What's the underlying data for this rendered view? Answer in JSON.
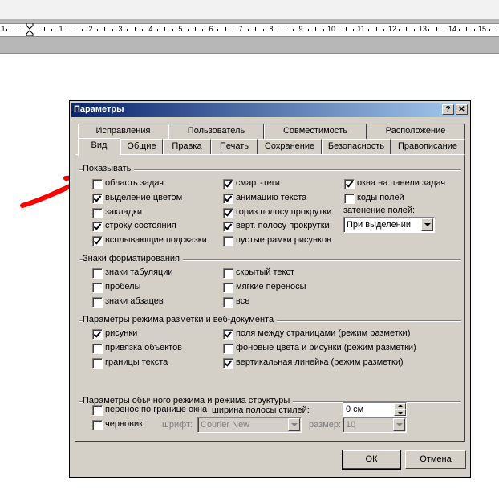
{
  "ruler": {
    "numbers": [
      "1",
      "1",
      "2",
      "3",
      "4",
      "5",
      "6",
      "7",
      "8",
      "9",
      "10",
      "11",
      "12",
      "13",
      "14",
      "15"
    ]
  },
  "dialog": {
    "title": "Параметры",
    "help_button": "?",
    "close_button": "✕",
    "tabs_back": [
      "Исправления",
      "Пользователь",
      "Совместимость",
      "Расположение"
    ],
    "tabs_front": [
      "Вид",
      "Общие",
      "Правка",
      "Печать",
      "Сохранение",
      "Безопасность",
      "Правописание"
    ],
    "active_tab": "Вид",
    "show": {
      "title": "Показывать",
      "col1": [
        {
          "label": "область задач",
          "checked": false
        },
        {
          "label": "выделение цветом",
          "checked": true
        },
        {
          "label": "закладки",
          "checked": false
        },
        {
          "label": "строку состояния",
          "checked": true
        },
        {
          "label": "всплывающие подсказки",
          "checked": true
        }
      ],
      "col2": [
        {
          "label": "смарт-теги",
          "checked": true
        },
        {
          "label": "анимацию текста",
          "checked": true
        },
        {
          "label": "гориз.полосу прокрутки",
          "checked": true
        },
        {
          "label": "верт. полосу прокрутки",
          "checked": true
        },
        {
          "label": "пустые рамки рисунков",
          "checked": false
        }
      ],
      "col3": [
        {
          "label": "окна на панели задач",
          "checked": true
        },
        {
          "label": "коды полей",
          "checked": false
        }
      ],
      "shading_label": "затенение полей:",
      "shading_value": "При выделении"
    },
    "formatting": {
      "title": "Знаки форматирования",
      "col1": [
        {
          "label": "знаки табуляции",
          "checked": false
        },
        {
          "label": "пробелы",
          "checked": false
        },
        {
          "label": "знаки абзацев",
          "checked": false
        }
      ],
      "col2": [
        {
          "label": "скрытый текст",
          "checked": false
        },
        {
          "label": "мягкие переносы",
          "checked": false
        },
        {
          "label": "все",
          "checked": false
        }
      ]
    },
    "layout": {
      "title": "Параметры режима разметки и веб-документа",
      "col1": [
        {
          "label": "рисунки",
          "checked": true
        },
        {
          "label": "привязка объектов",
          "checked": false
        },
        {
          "label": "границы текста",
          "checked": false
        }
      ],
      "col2": [
        {
          "label": "поля между страницами (режим разметки)",
          "checked": true
        },
        {
          "label": "фоновые цвета и рисунки (режим разметки)",
          "checked": false
        },
        {
          "label": "вертикальная линейка (режим разметки)",
          "checked": true
        }
      ]
    },
    "normal": {
      "title": "Параметры обычного режима и режима структуры",
      "wrap_label": "перенос по границе окна",
      "wrap_checked": false,
      "style_width_label": "ширина полосы стилей:",
      "style_width_value": "0 см",
      "draft_label": "черновик:",
      "draft_checked": false,
      "font_label": "шрифт:",
      "font_value": "Courier New",
      "size_label": "размер:",
      "size_value": "10"
    },
    "ok_label": "ОК",
    "cancel_label": "Отмена"
  },
  "colors": {
    "arrow": "#ff0000",
    "title_start": "#0a246a",
    "title_end": "#a6caf0",
    "face": "#d4d0c8"
  }
}
